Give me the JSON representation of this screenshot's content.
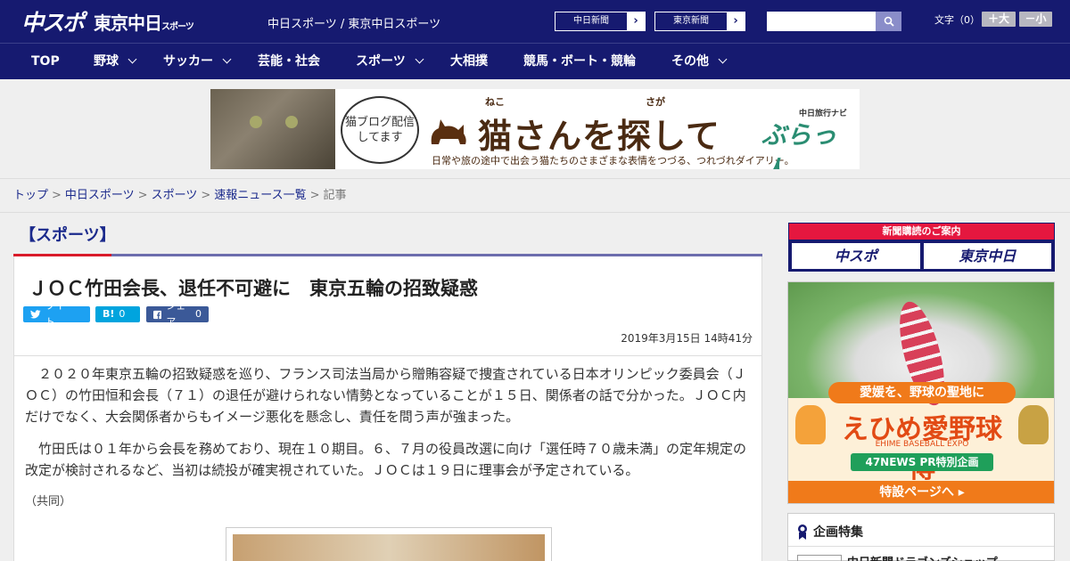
{
  "header": {
    "logo_main": "中スポ",
    "logo_sub": "東京中日",
    "logo_sub_small": "スポーツ",
    "site_name": "中日スポーツ / 東京中日スポーツ",
    "ext_links": [
      "中日新聞",
      "東京新聞"
    ],
    "font_size_label": "文字（0）",
    "font_up": "＋大",
    "font_down": "－小"
  },
  "nav": {
    "items": [
      {
        "label": "TOP",
        "dropdown": false
      },
      {
        "label": "野球",
        "dropdown": true
      },
      {
        "label": "サッカー",
        "dropdown": true
      },
      {
        "label": "芸能・社会",
        "dropdown": false
      },
      {
        "label": "スポーツ",
        "dropdown": true
      },
      {
        "label": "大相撲",
        "dropdown": false
      },
      {
        "label": "競馬・ボート・競輪",
        "dropdown": false
      },
      {
        "label": "その他",
        "dropdown": true
      }
    ]
  },
  "banner": {
    "bubble": "猫ブログ配信してます",
    "ruby_1": "ねこ",
    "ruby_2": "さが",
    "title": "猫さんを探して",
    "subtitle": "日常や旅の途中で出会う猫たちのさまざまな表情をつづる、つれづれダイアリー。",
    "brand_small": "中日旅行ナビ",
    "brand": "ぶらっ人"
  },
  "breadcrumb": {
    "items": [
      "トップ",
      "中日スポーツ",
      "スポーツ",
      "速報ニュース一覧"
    ],
    "current": "記事"
  },
  "article": {
    "category": "【スポーツ】",
    "title": "ＪＯＣ竹田会長、退任不可避に　東京五輪の招致疑惑",
    "share": {
      "tweet": "ツイート",
      "hatena_label": "B!",
      "hatena_count": "0",
      "fb_label": "シェア",
      "fb_count": "0"
    },
    "date": "2019年3月15日 14時41分",
    "paragraphs": [
      "２０２０年東京五輪の招致疑惑を巡り、フランス司法当局から贈賄容疑で捜査されている日本オリンピック委員会（ＪＯＣ）の竹田恒和会長（７１）の退任が避けられない情勢となっていることが１５日、関係者の話で分かった。ＪＯＣ内だけでなく、大会関係者からもイメージ悪化を懸念し、責任を問う声が強まった。",
      "竹田氏は０１年から会長を務めており、現在１０期目。６、７月の役員改選に向け「選任時７０歳未満」の定年規定の改定が検討されるなど、当初は続投が確実視されていた。ＪＯＣは１９日に理事会が予定されている。"
    ],
    "credit": "（共同）"
  },
  "sidebar": {
    "subscribe_head": "新聞購読のご案内",
    "subscribe_logos": [
      "中スポ",
      "東京中日"
    ],
    "ad": {
      "ribbon": "愛媛を、野球の聖地に",
      "title": "えひめ愛野球博",
      "en": "EHIME BASEBALL EXPO",
      "pr": "47NEWS PR特別企画",
      "button": "特設ページへ ▸"
    },
    "feature_head": "企画特集",
    "feature_item": "中日新聞ドラゴンズショップ"
  },
  "colors": {
    "navy": "#161a70",
    "accent_red": "#d91a2a",
    "link": "#1b2a8c",
    "twitter": "#1da1f2",
    "hatena": "#00a4de",
    "facebook": "#3b5998"
  }
}
